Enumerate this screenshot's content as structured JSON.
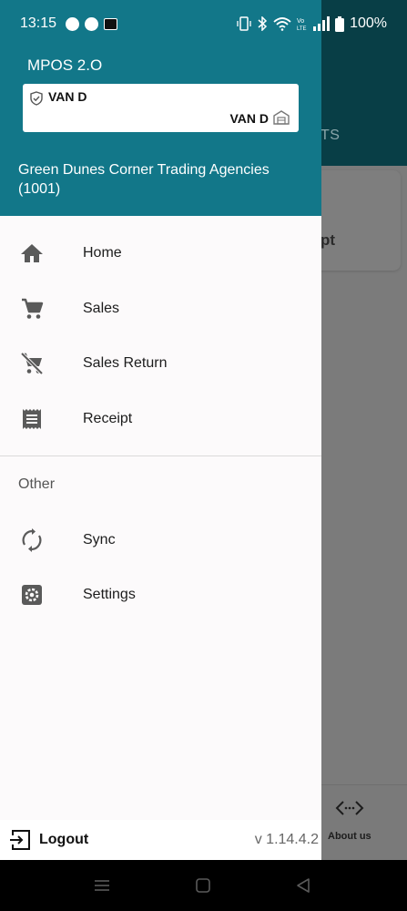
{
  "status_bar": {
    "time": "13:15",
    "battery": "100%"
  },
  "drawer": {
    "app_title": "MPOS 2.O",
    "van": {
      "top_label": "VAN D",
      "bottom_label": "VAN D"
    },
    "company": "Green Dunes Corner Trading Agencies (1001)",
    "menu": [
      {
        "label": "Home",
        "icon": "home-icon"
      },
      {
        "label": "Sales",
        "icon": "cart-icon"
      },
      {
        "label": "Sales Return",
        "icon": "cart-off-icon"
      },
      {
        "label": "Receipt",
        "icon": "receipt-icon"
      }
    ],
    "section_other": "Other",
    "other_menu": [
      {
        "label": "Sync",
        "icon": "sync-icon"
      },
      {
        "label": "Settings",
        "icon": "settings-icon"
      }
    ],
    "footer": {
      "logout_label": "Logout",
      "version": "v 1.14.4.2"
    }
  },
  "background": {
    "tab_fragment": "TS",
    "card_fragment": "pt",
    "about_label": "About us"
  },
  "colors": {
    "drawer_header": "#127789",
    "background_header": "#083e46",
    "scrim": "#7b7b7b"
  }
}
